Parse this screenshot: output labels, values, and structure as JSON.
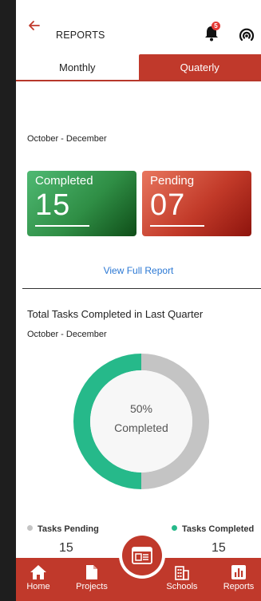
{
  "header": {
    "title": "REPORTS",
    "notification_count": "5"
  },
  "tabs": [
    {
      "label": "Monthly"
    },
    {
      "label": "Quaterly"
    }
  ],
  "summary": {
    "range": "October - December",
    "completed_label": "Completed",
    "completed_value": "15",
    "pending_label": "Pending",
    "pending_value": "07",
    "view_full_report": "View Full Report"
  },
  "total": {
    "title": "Total Tasks Completed in Last Quarter",
    "range": "October - December",
    "percent_text": "50%",
    "completed_text": "Completed"
  },
  "legend": {
    "pending_label": "Tasks Pending",
    "pending_value": "15",
    "completed_label": "Tasks Completed",
    "completed_value": "15"
  },
  "chart_data": {
    "type": "pie",
    "categories": [
      "Tasks Pending",
      "Tasks Completed"
    ],
    "values": [
      15,
      15
    ],
    "colors": [
      "#c4c4c4",
      "#26b98a"
    ]
  },
  "nav": [
    {
      "label": "Home",
      "icon": "home-icon"
    },
    {
      "label": "Projects",
      "icon": "document-icon"
    },
    {
      "label": "Schools",
      "icon": "building-icon"
    },
    {
      "label": "Reports",
      "icon": "bar-chart-icon"
    }
  ],
  "colors": {
    "accent": "#c0392b",
    "completed": "#26b98a",
    "pending": "#c4c4c4",
    "link": "#2b78d4"
  }
}
